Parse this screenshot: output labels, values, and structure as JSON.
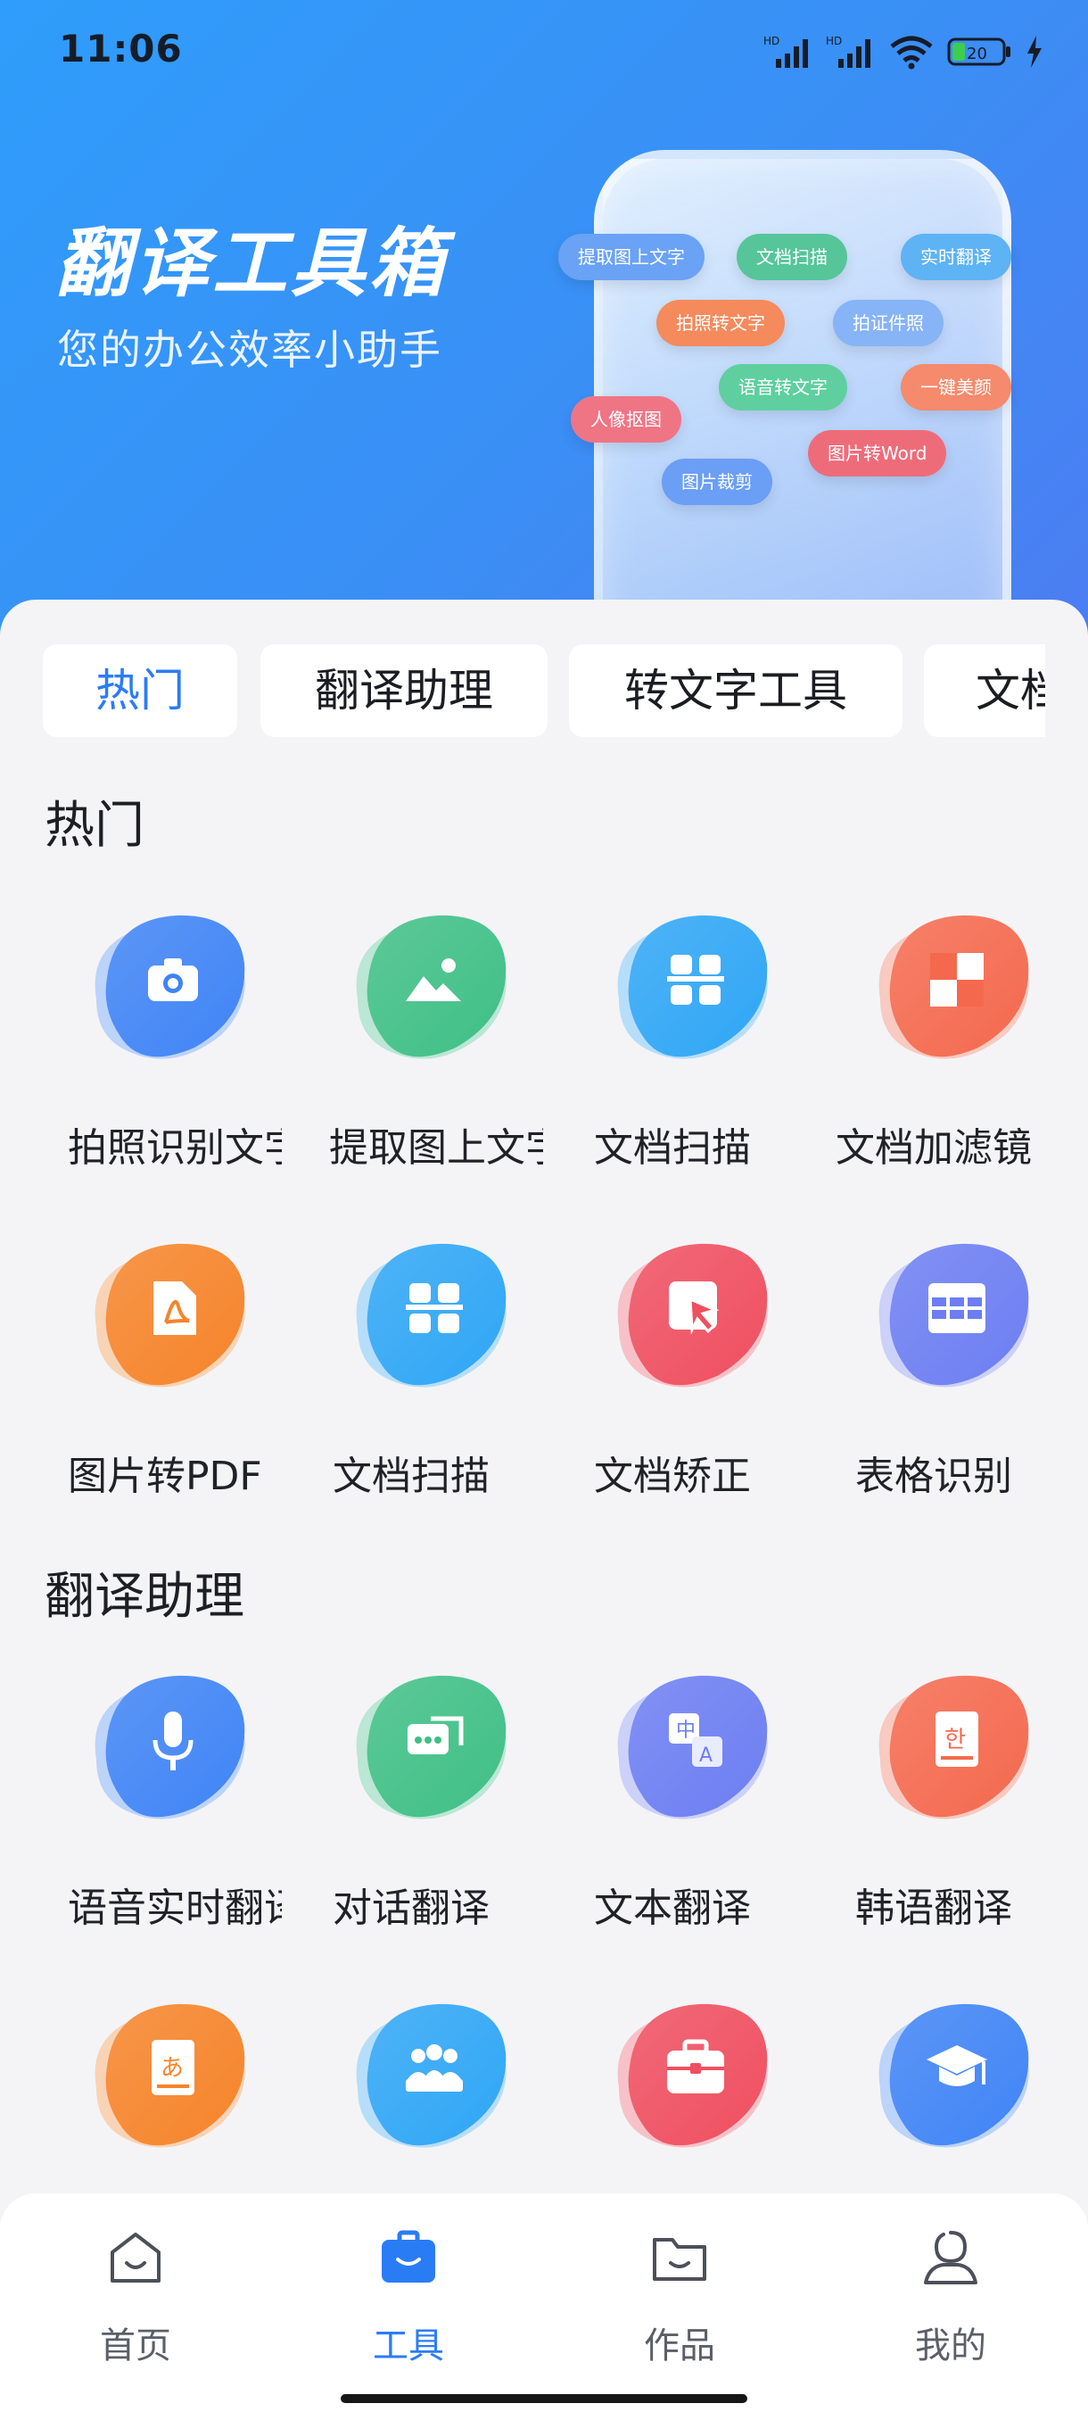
{
  "status_bar": {
    "time": "11:06",
    "battery": "20",
    "signal_label_1": "HD",
    "signal_label_2": "HD"
  },
  "hero": {
    "title": "翻译工具箱",
    "subtitle": "您的办公效率小助手",
    "chips": [
      {
        "label": "提取图上文字",
        "color": "#6aa2f5"
      },
      {
        "label": "文档扫描",
        "color": "#56c59a"
      },
      {
        "label": "实时翻译",
        "color": "#5eb3f5"
      },
      {
        "label": "拍照转文字",
        "color": "#f58a5c"
      },
      {
        "label": "拍证件照",
        "color": "#86b4f7"
      },
      {
        "label": "语音转文字",
        "color": "#5fcf9f"
      },
      {
        "label": "一键美颜",
        "color": "#f58a6c"
      },
      {
        "label": "人像抠图",
        "color": "#ef7585"
      },
      {
        "label": "图片转Word",
        "color": "#ee6c7a"
      },
      {
        "label": "图片裁剪",
        "color": "#6b9ef5"
      }
    ]
  },
  "tabs": [
    {
      "label": "热门"
    },
    {
      "label": "翻译助理"
    },
    {
      "label": "转文字工具"
    },
    {
      "label": "文档"
    }
  ],
  "sections": [
    {
      "title": "热门",
      "tools": [
        {
          "label": "拍照识别文字",
          "icon": "camera-icon",
          "color": "#3f84f5"
        },
        {
          "label": "提取图上文字",
          "icon": "image-icon",
          "color": "#3fbf86"
        },
        {
          "label": "文档扫描",
          "icon": "scan-icon",
          "color": "#2fa6f5"
        },
        {
          "label": "文档加滤镜",
          "icon": "filter-icon",
          "color": "#f4694e"
        },
        {
          "label": "图片转PDF",
          "icon": "pdf-icon",
          "color": "#f5842a"
        },
        {
          "label": "文档扫描",
          "icon": "scan-icon",
          "color": "#2fa6f5"
        },
        {
          "label": "文档矫正",
          "icon": "cursor-icon",
          "color": "#ef4f60"
        },
        {
          "label": "表格识别",
          "icon": "table-icon",
          "color": "#6c7ef2"
        }
      ]
    },
    {
      "title": "翻译助理",
      "tools": [
        {
          "label": "语音实时翻译",
          "icon": "microphone-icon",
          "color": "#3f84f5"
        },
        {
          "label": "对话翻译",
          "icon": "chat-icon",
          "color": "#3fbf86"
        },
        {
          "label": "文本翻译",
          "icon": "translate-icon",
          "color": "#6c7ef2"
        },
        {
          "label": "韩语翻译",
          "icon": "korean-book-icon",
          "color": "#f4694e"
        },
        {
          "label": "",
          "icon": "japanese-book-icon",
          "color": "#f5842a"
        },
        {
          "label": "",
          "icon": "meeting-icon",
          "color": "#2fa6f5"
        },
        {
          "label": "",
          "icon": "briefcase-icon",
          "color": "#ef4f60"
        },
        {
          "label": "",
          "icon": "graduation-cap-icon",
          "color": "#3f84f5"
        }
      ]
    }
  ],
  "bottom_nav": [
    {
      "label": "首页",
      "icon": "home-icon",
      "active": false
    },
    {
      "label": "工具",
      "icon": "toolbox-icon",
      "active": true
    },
    {
      "label": "作品",
      "icon": "folder-icon",
      "active": false
    },
    {
      "label": "我的",
      "icon": "profile-icon",
      "active": false
    }
  ],
  "colors": {
    "accent": "#2a7cf5",
    "hero_gradient_start": "#2f9dfb",
    "hero_gradient_end": "#4c7df2",
    "background": "#f4f4f6"
  }
}
